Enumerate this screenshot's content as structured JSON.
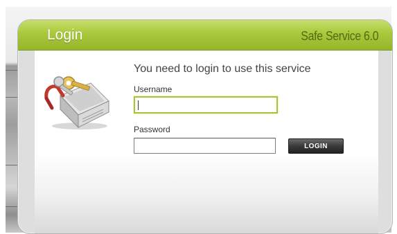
{
  "dialog": {
    "title": "Login",
    "brand": "Safe Service 6.0",
    "prompt": "You need to login to use this service"
  },
  "form": {
    "username_label": "Username",
    "username_value": "",
    "password_label": "Password",
    "password_value": "",
    "login_button": "LOGIN"
  },
  "colors": {
    "header_green": "#a9c83c",
    "brand_text": "#556b10",
    "focus_border": "#a9c23a",
    "button": "#2e2e2e"
  },
  "icons": {
    "illustration": "keys-and-lock-box-icon"
  }
}
